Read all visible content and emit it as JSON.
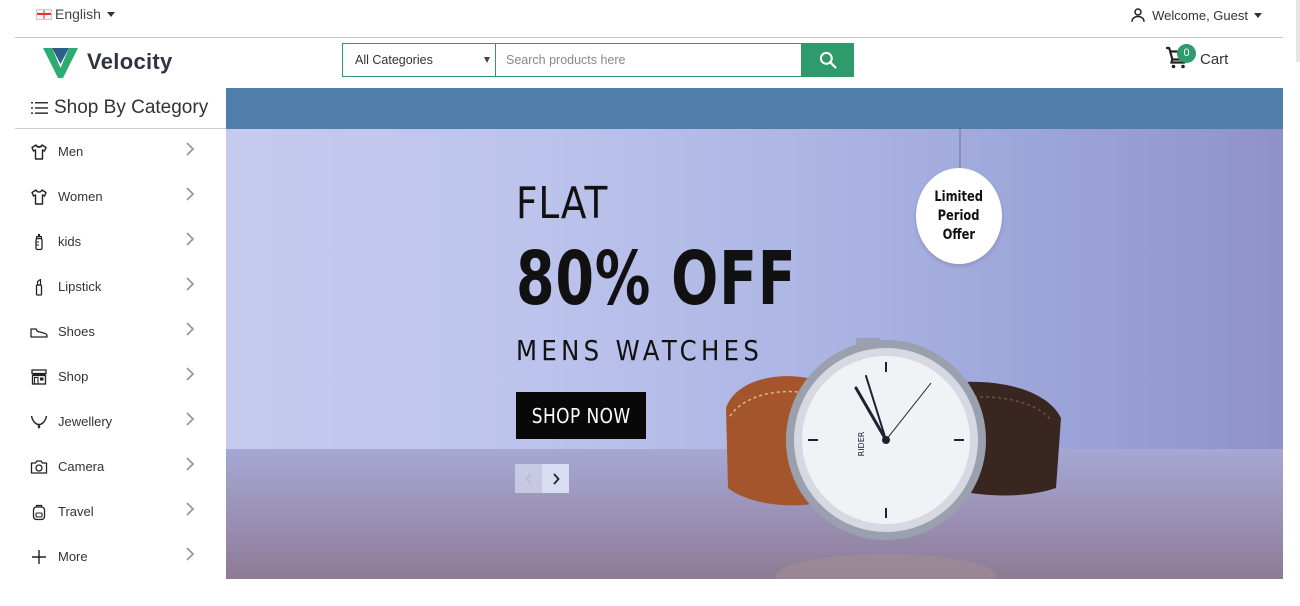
{
  "topbar": {
    "language": "English",
    "welcome": "Welcome, Guest"
  },
  "header": {
    "logo_text": "Velocity",
    "category_select": "All Categories",
    "search_placeholder": "Search products here",
    "cart_label": "Cart",
    "cart_count": "0"
  },
  "sidebar": {
    "title": "Shop By Category",
    "items": [
      {
        "label": "Men",
        "icon": "tshirt-icon"
      },
      {
        "label": "Women",
        "icon": "shirt-icon"
      },
      {
        "label": "kids",
        "icon": "baby-bottle-icon"
      },
      {
        "label": "Lipstick",
        "icon": "lipstick-icon"
      },
      {
        "label": "Shoes",
        "icon": "shoe-icon"
      },
      {
        "label": "Shop",
        "icon": "store-icon"
      },
      {
        "label": "Jewellery",
        "icon": "necklace-icon"
      },
      {
        "label": "Camera",
        "icon": "camera-icon"
      },
      {
        "label": "Travel",
        "icon": "backpack-icon"
      },
      {
        "label": "More",
        "icon": "plus-icon"
      }
    ]
  },
  "banner": {
    "line1": "FLAT",
    "line2": "80% OFF",
    "line3": "MENS WATCHES",
    "cta": "SHOP NOW",
    "tag": [
      "Limited",
      "Period",
      "Offer"
    ],
    "watch_brand": "RIDER"
  },
  "colors": {
    "accent": "#2f9b6c",
    "band": "#4f7eaa",
    "logo_green": "#2eaa73",
    "logo_blue": "#2c5f8a"
  }
}
